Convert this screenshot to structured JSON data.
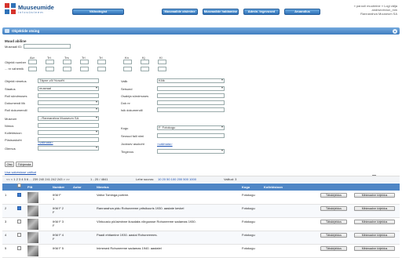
{
  "header": {
    "brand": "Muuseumide",
    "brand_sub": "infosüsteem",
    "nav": [
      "Välisvärgist",
      "Museaalide otsimine",
      "Museaalide haldamine",
      "Admin. tegevused",
      "Aruandlus"
    ],
    "user_lines": [
      "» parooli muutmine  » Logi välja",
      "andrsevirvion_min",
      "Rannarahva Muuseum SA"
    ]
  },
  "panel": {
    "title": "Objektide otsing"
  },
  "form": {
    "group_title": "Muud abiline",
    "museum_id_label": "Museaali ID:",
    "obj_number_label": "Objekti number",
    "range_label": "... nr vahemik",
    "obj_cols": [
      "Acr",
      "Trt",
      "Trs",
      "Trl",
      "Trl",
      "Kn",
      "Kj",
      "Kl"
    ],
    "left_fields": [
      {
        "label": "Objekti nimetus",
        "value": "Täpne või %osa%"
      },
      {
        "label": "Staatus",
        "value": "museaal"
      },
      {
        "label": "Roll sündmuses",
        "value": ""
      },
      {
        "label": "Dokumendi liik",
        "value": ""
      },
      {
        "label": "Roll dokumendil",
        "value": ""
      },
      {
        "label": "Museum",
        "value": "...Rannarahva Muuseum SA"
      },
      {
        "label": "Nimus",
        "value": ""
      },
      {
        "label": "Kollektsioon",
        "value": ""
      },
      {
        "label": "Püsisuskoht",
        "value": ""
      },
      {
        "label": "Olemus",
        "value": ""
      }
    ],
    "valimata_link": "<valimata>",
    "right_fields": [
      {
        "label": "Valik",
        "value": "Kõik"
      },
      {
        "label": "Seisund",
        "value": ""
      },
      {
        "label": "Osaleja sündmuses",
        "value": ""
      },
      {
        "label": "Dok nr",
        "value": ""
      },
      {
        "label": "Isik dokumendil",
        "value": ""
      }
    ],
    "right_fields2": [
      {
        "label": "Kogu",
        "value": "F: Fotokogu"
      },
      {
        "label": "Seosud faili nimi",
        "value": ""
      },
      {
        "label": "Jooksev asukoht",
        "value": "<valimata>"
      },
      {
        "label": "Tingevus",
        "value": ""
      }
    ],
    "buttons": [
      "Otsi",
      "Tühjenda"
    ],
    "saved_link": "Lisa salvestuse valitud",
    "select_all": "vali kõik"
  },
  "pager": {
    "pages": "<< < 1 2 3 4 5 6 ... 239 240 241 242 243 > >>",
    "range": "1 - 20 / 4841",
    "per_page_label": "Lehe suurus:",
    "per_page": "10  20  50  100  200  500  1000",
    "selected": "Valitud: 3"
  },
  "table": {
    "headers": [
      "",
      "Pilt",
      "Number",
      "Autor",
      "Nimetus",
      "Kogu",
      "Kollektsioon",
      "",
      ""
    ],
    "rows": [
      {
        "num": "1",
        "code": "IKM F\n1",
        "name": "Valtor Tominga portree.",
        "kogu": "Fotokogu",
        "checked": true
      },
      {
        "num": "2",
        "code": "IKM F 2\nF",
        "name": "Rannarahva pidu Rohuneeme pritsikuuris 1930. aastate kevkel",
        "kogu": "Fotokogu",
        "checked": true
      },
      {
        "num": "3",
        "code": "IKM F 3\nF",
        "name": "Võrkuuslu püüsiminne ilusalaks võrguosse Rohuneeme sadamas 1930.",
        "kogu": "Fotokogu",
        "checked": false
      },
      {
        "num": "4",
        "code": "IKM F 4\nF",
        "name": "Paadi ehitamine 1930. aastal Rohuneemes.",
        "kogu": "Fotokogu",
        "checked": false
      },
      {
        "num": "5",
        "code": "IKM F 5",
        "name": "Inimesed Rohuneeme sadamas 1940. aastatel",
        "kogu": "Fotokogu",
        "checked": false
      }
    ],
    "row_btn1": "Täiskirjeldus",
    "row_btn2": "Minimaalne kirjeldus"
  },
  "colors": {
    "accent": "#3f7ec0",
    "header_blue": "#4f86c6",
    "link": "#1a4fb0"
  }
}
